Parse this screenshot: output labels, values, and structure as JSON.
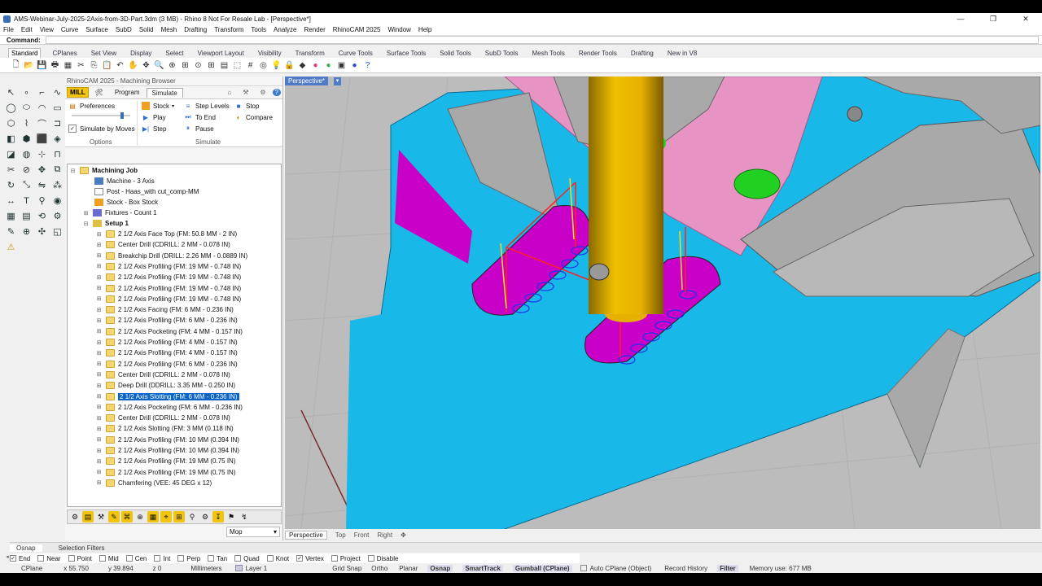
{
  "window": {
    "title": "AMS-Webinar-July-2025-2Axis-from-3D-Part.3dm (3 MB) - Rhino 8 Not For Resale Lab - [Perspective*]"
  },
  "menu": [
    "File",
    "Edit",
    "View",
    "Curve",
    "Surface",
    "SubD",
    "Solid",
    "Mesh",
    "Drafting",
    "Transform",
    "Tools",
    "Analyze",
    "Render",
    "RhinoCAM 2025",
    "Window",
    "Help"
  ],
  "command": {
    "label": "Command:"
  },
  "toolbar_tabs": [
    "Standard",
    "CPlanes",
    "Set View",
    "Display",
    "Select",
    "Viewport Layout",
    "Visibility",
    "Transform",
    "Curve Tools",
    "Surface Tools",
    "Solid Tools",
    "SubD Tools",
    "Mesh Tools",
    "Render Tools",
    "Drafting",
    "New in V8"
  ],
  "toolbar_icons": [
    "new",
    "open",
    "save",
    "print",
    "import",
    "cut",
    "copy",
    "paste",
    "undo",
    "pan",
    "rotate",
    "zoom",
    "zoom-window",
    "zoom-extents",
    "zoom-selected",
    "4view",
    "cplane",
    "select",
    "grid",
    "osnap",
    "light",
    "lock",
    "layer",
    "color",
    "materials",
    "properties",
    "render",
    "help"
  ],
  "panel": {
    "title": "RhinoCAM 2025 - Machining Browser",
    "tabs": {
      "mill": "MILL",
      "program": "Program",
      "simulate": "Simulate"
    },
    "options": {
      "preferences": "Preferences",
      "simulate_by_moves": "Simulate by Moves",
      "label": "Options"
    },
    "simulate": {
      "stock": "Stock",
      "play": "Play",
      "step": "Step",
      "step_levels": "Step Levels",
      "to_end": "To End",
      "pause": "Pause",
      "stop": "Stop",
      "compare": "Compare",
      "label": "Simulate"
    },
    "tree": {
      "root": "Machining Job",
      "machine": "Machine - 3 Axis",
      "post": "Post - Haas_with cut_comp-MM",
      "stock": "Stock - Box Stock",
      "fixtures": "Fixtures - Count 1",
      "setup": "Setup 1",
      "operations": [
        "2 1/2 Axis Face Top (FM: 50.8 MM - 2 IN)",
        "Center Drill (CDRILL: 2 MM - 0.078 IN)",
        "Breakchip Drill (DRILL: 2.26 MM - 0.0889 IN)",
        "2 1/2 Axis Profiling (FM: 19 MM - 0.748 IN)",
        "2 1/2 Axis Profiling (FM: 19 MM - 0.748 IN)",
        "2 1/2 Axis Profiling  (FM: 19 MM - 0.748 IN)",
        "2 1/2 Axis Profiling (FM: 19 MM - 0.748 IN)",
        "2 1/2 Axis Facing (FM: 6 MM - 0.236 IN)",
        "2 1/2 Axis Profiling (FM: 6 MM - 0.236 IN)",
        "2 1/2 Axis Pocketing (FM: 4 MM - 0.157 IN)",
        "2 1/2 Axis Profiling (FM: 4 MM - 0.157 IN)",
        "2 1/2 Axis Profiling (FM: 4 MM - 0.157 IN)",
        "2 1/2 Axis Profiling (FM: 6 MM - 0.236 IN)",
        "Center Drill (CDRILL: 2 MM - 0.078 IN)",
        "Deep Drill  (DDRILL: 3.35 MM - 0.250 IN)",
        "2 1/2 Axis Slotting (FM: 6 MM - 0.236 IN)",
        "2 1/2 Axis Pocketing (FM: 6 MM - 0.236 IN)",
        "Center Drill (CDRILL: 2 MM - 0.078 IN)",
        "2 1/2 Axis Slotting (FM: 3 MM (0.118 IN)",
        "2 1/2 Axis Profiling (FM: 10 MM (0.394 IN)",
        "2 1/2 Axis Profiling (FM: 10 MM (0.394 IN)",
        "2 1/2 Axis Profiling (FM: 19 MM (0.75 IN)",
        "2 1/2 Axis Profiling (FM: 19 MM (0.75 IN)",
        "Chamfering (VEE: 45 DEG x 12)"
      ],
      "selected_index": 15
    },
    "mop_select": "Mop"
  },
  "viewport": {
    "label": "Perspective*",
    "tabs": [
      "Perspective",
      "Top",
      "Front",
      "Right"
    ]
  },
  "osnap_tabs": [
    "Osnap",
    "Selection Filters"
  ],
  "osnaps": [
    {
      "label": "End",
      "checked": true
    },
    {
      "label": "Near",
      "checked": false
    },
    {
      "label": "Point",
      "checked": false
    },
    {
      "label": "Mid",
      "checked": false
    },
    {
      "label": "Cen",
      "checked": false
    },
    {
      "label": "Int",
      "checked": false
    },
    {
      "label": "Perp",
      "checked": false
    },
    {
      "label": "Tan",
      "checked": false
    },
    {
      "label": "Quad",
      "checked": false
    },
    {
      "label": "Knot",
      "checked": false
    },
    {
      "label": "Vertex",
      "checked": true
    },
    {
      "label": "Project",
      "checked": false
    },
    {
      "label": "Disable",
      "checked": false
    }
  ],
  "status": {
    "cplane": "CPlane",
    "x": "x 55.750",
    "y": "y 39.894",
    "z": "z 0",
    "units": "Millimeters",
    "layer": "Layer 1",
    "grid_snap": "Grid Snap",
    "ortho": "Ortho",
    "planar": "Planar",
    "osnap": "Osnap",
    "smarttrack": "SmartTrack",
    "gumball": "Gumball (CPlane)",
    "auto_cplane": "Auto CPlane (Object)",
    "record_history": "Record History",
    "filter": "Filter",
    "memory": "Memory use: 677 MB"
  },
  "colors": {
    "stock_top": "#18b8e8",
    "walls": "#a9a9a9",
    "pocket": "#e793c4",
    "tool": "#e6b000",
    "slot": "#c800c8",
    "drill": "#22d022",
    "viewport_bg": "#bcbcbc"
  }
}
